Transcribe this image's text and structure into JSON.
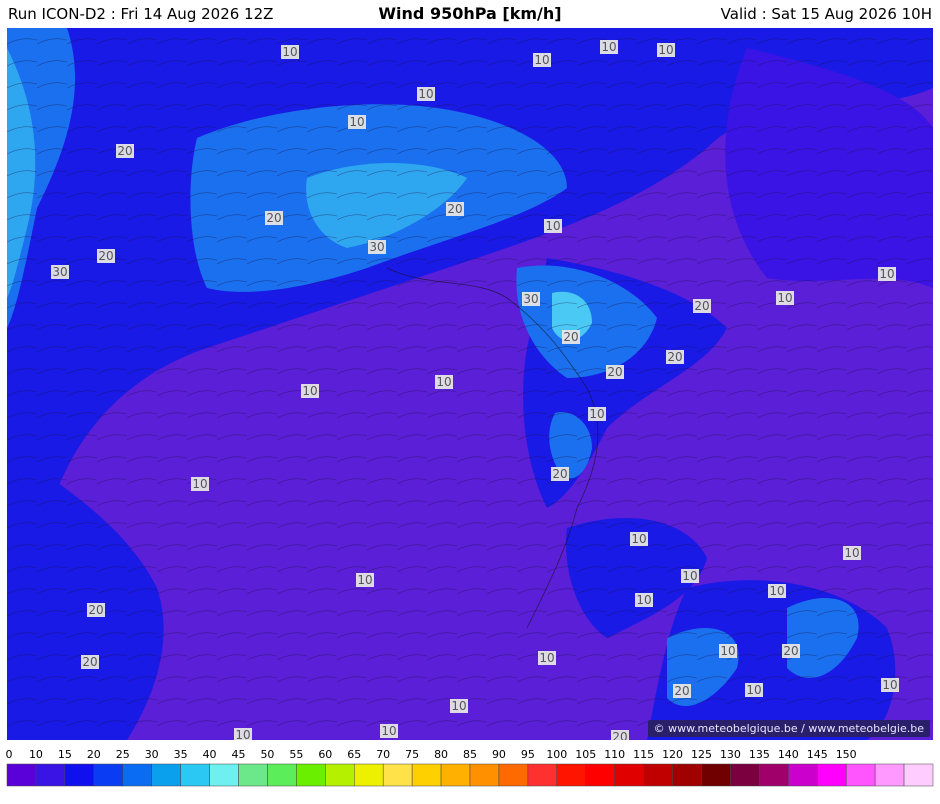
{
  "header": {
    "run": "Run ICON-D2 : Fri 14 Aug 2026 12Z",
    "title": "Wind 950hPa [km/h]",
    "valid": "Valid : Sat 15 Aug 2026 10H"
  },
  "credit": "© www.meteobelgique.be / www.meteobelgie.be",
  "colors": {
    "background_violet": "#5a1fd6",
    "blue_10": "#1a1ae6",
    "blue_15": "#0f3cff",
    "light_blue_20": "#1a70ee",
    "cyan_25": "#2fa6f0",
    "cyan_30": "#4bc9f5"
  },
  "legend": {
    "labels": [
      "0",
      "10",
      "15",
      "20",
      "25",
      "30",
      "35",
      "40",
      "45",
      "50",
      "55",
      "60",
      "65",
      "70",
      "75",
      "80",
      "85",
      "90",
      "95",
      "100",
      "105",
      "110",
      "115",
      "120",
      "125",
      "130",
      "135",
      "140",
      "145",
      "150"
    ],
    "colors": [
      "#5a00d8",
      "#3a14e4",
      "#1010ee",
      "#0a3cf4",
      "#0a6cf2",
      "#0aa0ee",
      "#2cc8f4",
      "#6ef0f0",
      "#6ce88a",
      "#5cee5a",
      "#6aef00",
      "#b4f000",
      "#eef000",
      "#ffe24a",
      "#ffd000",
      "#ffb000",
      "#ff9000",
      "#ff6a00",
      "#ff3030",
      "#ff1400",
      "#ff0000",
      "#e00000",
      "#c00000",
      "#a00000",
      "#700000",
      "#7a0040",
      "#a0006a",
      "#cc00cc",
      "#ff00ff",
      "#ff55ff",
      "#ff99ff",
      "#ffccff"
    ]
  },
  "isotach_labels": [
    {
      "text": "10"
    },
    {
      "text": "10"
    },
    {
      "text": "10"
    },
    {
      "text": "10"
    },
    {
      "text": "10"
    },
    {
      "text": "10"
    },
    {
      "text": "20"
    },
    {
      "text": "20"
    },
    {
      "text": "30"
    },
    {
      "text": "20"
    },
    {
      "text": "30"
    },
    {
      "text": "20"
    },
    {
      "text": "10"
    },
    {
      "text": "30"
    },
    {
      "text": "20"
    },
    {
      "text": "20"
    },
    {
      "text": "20"
    },
    {
      "text": "20"
    },
    {
      "text": "10"
    },
    {
      "text": "10"
    },
    {
      "text": "10"
    },
    {
      "text": "10"
    },
    {
      "text": "10"
    },
    {
      "text": "10"
    },
    {
      "text": "20"
    },
    {
      "text": "10"
    },
    {
      "text": "10"
    },
    {
      "text": "10"
    },
    {
      "text": "10"
    },
    {
      "text": "10"
    },
    {
      "text": "10"
    },
    {
      "text": "10"
    },
    {
      "text": "20"
    },
    {
      "text": "20"
    },
    {
      "text": "10"
    },
    {
      "text": "20"
    },
    {
      "text": "20"
    },
    {
      "text": "10"
    },
    {
      "text": "10"
    },
    {
      "text": "10"
    },
    {
      "text": "20"
    },
    {
      "text": "10"
    },
    {
      "text": "10"
    },
    {
      "text": "10"
    },
    {
      "text": "10"
    }
  ]
}
